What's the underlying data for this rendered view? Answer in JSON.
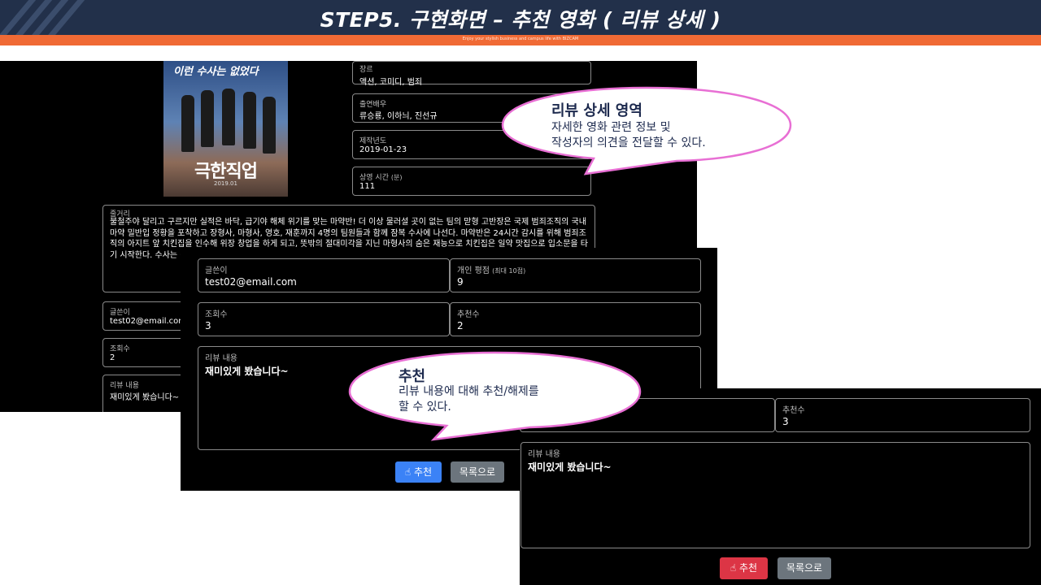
{
  "header": {
    "title": "STEP5.  구현화면 – 추천 영화 ( 리뷰 상세 )",
    "subline": "Enjoy your stylish business and campus life with BIZCAM"
  },
  "panel1": {
    "poster": {
      "top_text": "이런 수사는 없었다",
      "title": "극한직업",
      "date": "2019.01"
    },
    "genre": {
      "label": "장르",
      "value": "액션, 코미디, 범죄"
    },
    "cast": {
      "label": "출연배우",
      "value": "류승룡, 이하늬, 진선규"
    },
    "year": {
      "label": "제작년도",
      "value": "2019-01-23"
    },
    "runtime": {
      "label": "상영 시간",
      "unit": "(분)",
      "value": "111"
    },
    "plot": {
      "label": "줄거리",
      "value": "불철주야 달리고 구르지만 실적은 바닥, 급기야 해체 위기를 맞는 마약반! 더 이상 물러설 곳이 없는 팀의 맏형 고반장은 국제 범죄조직의 국내 마약 밀반입 정황을 포착하고 장형사, 마형사, 영호, 재훈까지 4명의 팀원들과 함께 잠복 수사에 나선다. 마약반은 24시간 감시를 위해 범죄조직의 아지트 앞 치킨집을 인수해 위장 창업을 하게 되고, 뜻밖의 절대미각을 지닌 마형사의 숨은 재능으로 치킨집은 일약 맛집으로 입소문을 타기 시작한다. 수사는 뒷전, 치킨장사로 눈코 뜰 새 없이 바빠진 마약반에게 어느 날 절호의 기회가 찾아오는데..."
    },
    "writer": {
      "label": "글쓴이",
      "value": "test02@email.com"
    },
    "views": {
      "label": "조회수",
      "value": "2"
    },
    "review": {
      "label": "리뷰 내용",
      "value": "재미있게 봤습니다~"
    }
  },
  "panel2": {
    "writer": {
      "label": "글쓴이",
      "value": "test02@email.com"
    },
    "rating": {
      "label": "개인 평점",
      "unit": "(최대 10점)",
      "value": "9"
    },
    "views": {
      "label": "조회수",
      "value": "3"
    },
    "recommend": {
      "label": "추천수",
      "value": "2"
    },
    "review": {
      "label": "리뷰 내용",
      "value": "재미있게 봤습니다~"
    },
    "recommend_button": "추천",
    "list_button": "목록으로"
  },
  "panel3": {
    "recommend": {
      "label": "추천수",
      "value": "3"
    },
    "review": {
      "label": "리뷰 내용",
      "value": "재미있게 봤습니다~"
    },
    "recommend_button": "추천",
    "list_button": "목록으로"
  },
  "callouts": {
    "detail": {
      "title": "리뷰 상세 영역",
      "line1": "자세한 영화 관련 정보 및",
      "line2": "작성자의 의견을 전달할 수 있다."
    },
    "recommend": {
      "title": "추천",
      "line1": "리뷰 내용에 대해 추천/해제를",
      "line2": "할 수 있다."
    }
  },
  "colors": {
    "header_bg": "#22304a",
    "accent_orange": "#f06a35",
    "callout_border": "#e86fd4",
    "recommend_blue": "#3b82f6",
    "recommend_red": "#dc3545"
  }
}
